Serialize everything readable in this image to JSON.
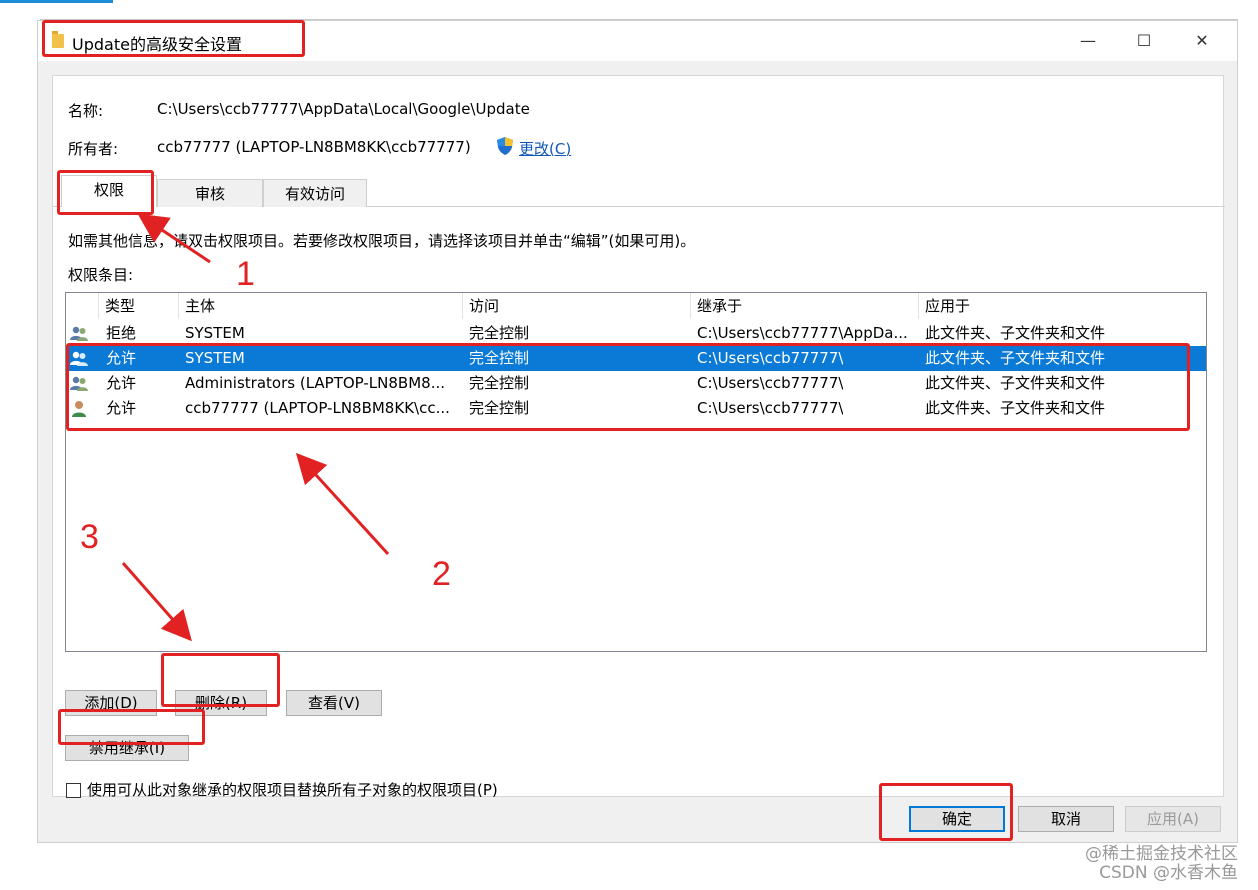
{
  "window": {
    "title": "Update的高级安全设置",
    "controls": {
      "minimize": "—",
      "maximize": "☐",
      "close": "✕"
    }
  },
  "info": {
    "name_label": "名称:",
    "name_value": "C:\\Users\\ccb77777\\AppData\\Local\\Google\\Update",
    "owner_label": "所有者:",
    "owner_value": "ccb77777 (LAPTOP-LN8BM8KK\\ccb77777)",
    "change_link": "更改(C)"
  },
  "tabs": [
    {
      "label": "权限",
      "active": true
    },
    {
      "label": "审核",
      "active": false
    },
    {
      "label": "有效访问",
      "active": false
    }
  ],
  "hint_text": "如需其他信息，请双击权限项目。若要修改权限项目，请选择该项目并单击“编辑”(如果可用)。",
  "entries_label": "权限条目:",
  "table": {
    "columns": [
      "类型",
      "主体",
      "访问",
      "继承于",
      "应用于"
    ],
    "rows": [
      {
        "type": "拒绝",
        "principal": "SYSTEM",
        "access": "完全控制",
        "inherited": "C:\\Users\\ccb77777\\AppDa...",
        "applies": "此文件夹、子文件夹和文件",
        "icon": "group-users-icon",
        "selected": false
      },
      {
        "type": "允许",
        "principal": "SYSTEM",
        "access": "完全控制",
        "inherited": "C:\\Users\\ccb77777\\",
        "applies": "此文件夹、子文件夹和文件",
        "icon": "group-users-icon",
        "selected": true
      },
      {
        "type": "允许",
        "principal": "Administrators (LAPTOP-LN8BM8...",
        "access": "完全控制",
        "inherited": "C:\\Users\\ccb77777\\",
        "applies": "此文件夹、子文件夹和文件",
        "icon": "group-users-icon",
        "selected": false
      },
      {
        "type": "允许",
        "principal": "ccb77777 (LAPTOP-LN8BM8KK\\cc...",
        "access": "完全控制",
        "inherited": "C:\\Users\\ccb77777\\",
        "applies": "此文件夹、子文件夹和文件",
        "icon": "single-user-icon",
        "selected": false
      }
    ]
  },
  "buttons": {
    "add": "添加(D)",
    "remove": "删除(R)",
    "view": "查看(V)",
    "disable_inherit": "禁用继承(I)",
    "ok": "确定",
    "cancel": "取消",
    "apply": "应用(A)"
  },
  "replace_checkbox": {
    "label": "使用可从此对象继承的权限项目替换所有子对象的权限项目(P)",
    "checked": false
  },
  "annotations": {
    "n1": "1",
    "n2": "2",
    "n3": "3",
    "color": "#e22222"
  },
  "watermark": {
    "line1": "@稀土掘金技术社区",
    "line2": "CSDN @水香木鱼"
  }
}
